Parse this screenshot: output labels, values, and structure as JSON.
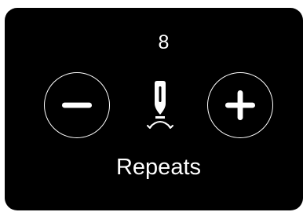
{
  "repeats": {
    "count": "8",
    "label": "Repeats"
  },
  "icons": {
    "decrement": "minus-icon",
    "increment": "plus-icon",
    "center": "needle-repeat-icon"
  },
  "colors": {
    "background": "#000000",
    "foreground": "#ffffff"
  }
}
